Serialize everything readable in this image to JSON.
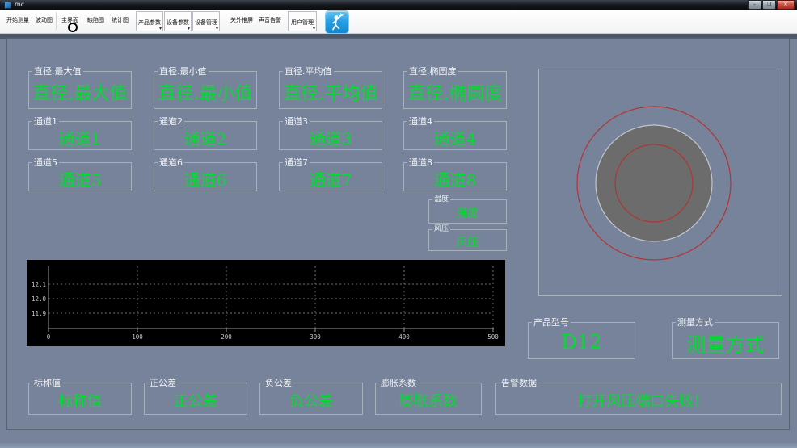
{
  "window": {
    "title": "mc",
    "minimize_glyph": "–",
    "maximize_glyph": "❐",
    "close_glyph": "✕"
  },
  "toolbar": {
    "start": "开始测量",
    "wave": "波动图",
    "main": "主界面",
    "defect": "缺陷图",
    "stats": "统计图",
    "product_params": "产品参数",
    "device_params": "设备参数",
    "device_mgmt": "设备管理",
    "ext_screen": "关外推屏",
    "sound_alarm": "声音告警",
    "user_mgmt": "用户管理",
    "dropdown_glyph": "▾"
  },
  "panels": {
    "diameter": [
      {
        "label": "直径.最大值",
        "value": "直径.最大值"
      },
      {
        "label": "直径.最小值",
        "value": "直径.最小值"
      },
      {
        "label": "直径.平均值",
        "value": "直径.平均值"
      },
      {
        "label": "直径.椭圆度",
        "value": "直径.椭圆度"
      }
    ],
    "channels": [
      {
        "label": "通道1",
        "value": "通道1"
      },
      {
        "label": "通道2",
        "value": "通道2"
      },
      {
        "label": "通道3",
        "value": "通道3"
      },
      {
        "label": "通道4",
        "value": "通道4"
      },
      {
        "label": "通道5",
        "value": "通道5"
      },
      {
        "label": "通道6",
        "value": "通道6"
      },
      {
        "label": "通道7",
        "value": "通道7"
      },
      {
        "label": "通道8",
        "value": "通道8"
      }
    ],
    "temperature": {
      "label": "温度",
      "value": "温度"
    },
    "air_pressure": {
      "label": "风压",
      "value": "风压"
    },
    "product_model": {
      "label": "产品型号",
      "value": "D12"
    },
    "measure_mode": {
      "label": "测量方式",
      "value": "测量方式"
    },
    "nominal": {
      "label": "标称值",
      "value": "标称值"
    },
    "pos_tolerance": {
      "label": "正公差",
      "value": "正公差"
    },
    "neg_tolerance": {
      "label": "负公差",
      "value": "负公差"
    },
    "expansion": {
      "label": "膨胀系数",
      "value": "膨胀系数"
    },
    "alarm": {
      "label": "告警数据",
      "value": "打开风压端口失败!"
    }
  },
  "chart_data": {
    "type": "line",
    "title": "",
    "xlabel": "",
    "ylabel": "",
    "xlim": [
      0,
      500
    ],
    "ylim": [
      11.85,
      12.2
    ],
    "x_tick_labels": [
      "0",
      "100",
      "200",
      "300",
      "400",
      "500"
    ],
    "y_tick_labels": [
      "12.1",
      "12.0",
      "11.9"
    ],
    "grid": true,
    "legend": false,
    "background": "#000000",
    "series": []
  },
  "colors": {
    "value_green": "#00df2d",
    "panel_bg": "#76839a",
    "chart_bg": "#000000",
    "ring_red": "#b23434",
    "disc_gray": "#6c6c6c",
    "toolbar_bg": "#f5f6f7",
    "titlebar_bg": "#14171c"
  }
}
